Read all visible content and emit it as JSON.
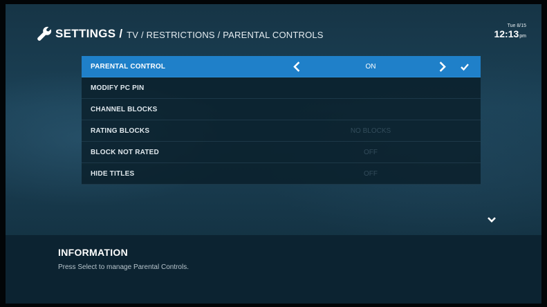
{
  "header": {
    "title": "SETTINGS",
    "separator": "/",
    "path": "TV / RESTRICTIONS / PARENTAL CONTROLS"
  },
  "clock": {
    "date": "Tue 8/15",
    "time": "12:13",
    "ampm": "pm"
  },
  "menu": {
    "items": [
      {
        "label": "PARENTAL CONTROL",
        "value": "ON"
      },
      {
        "label": "MODIFY PC PIN",
        "value": ""
      },
      {
        "label": "CHANNEL BLOCKS",
        "value": ""
      },
      {
        "label": "RATING BLOCKS",
        "value": "NO BLOCKS"
      },
      {
        "label": "BLOCK NOT RATED",
        "value": "OFF"
      },
      {
        "label": "HIDE TITLES",
        "value": "OFF"
      }
    ]
  },
  "info": {
    "title": "INFORMATION",
    "text": "Press Select to manage Parental Controls."
  },
  "colors": {
    "selected": "#1f80c9",
    "background": "#183a4d",
    "info_panel": "#0c2331"
  },
  "icons": {
    "header": "wrench-icon",
    "prev": "chevron-left-icon",
    "next": "chevron-right-icon",
    "confirm": "check-icon",
    "scroll": "chevron-down-icon"
  }
}
